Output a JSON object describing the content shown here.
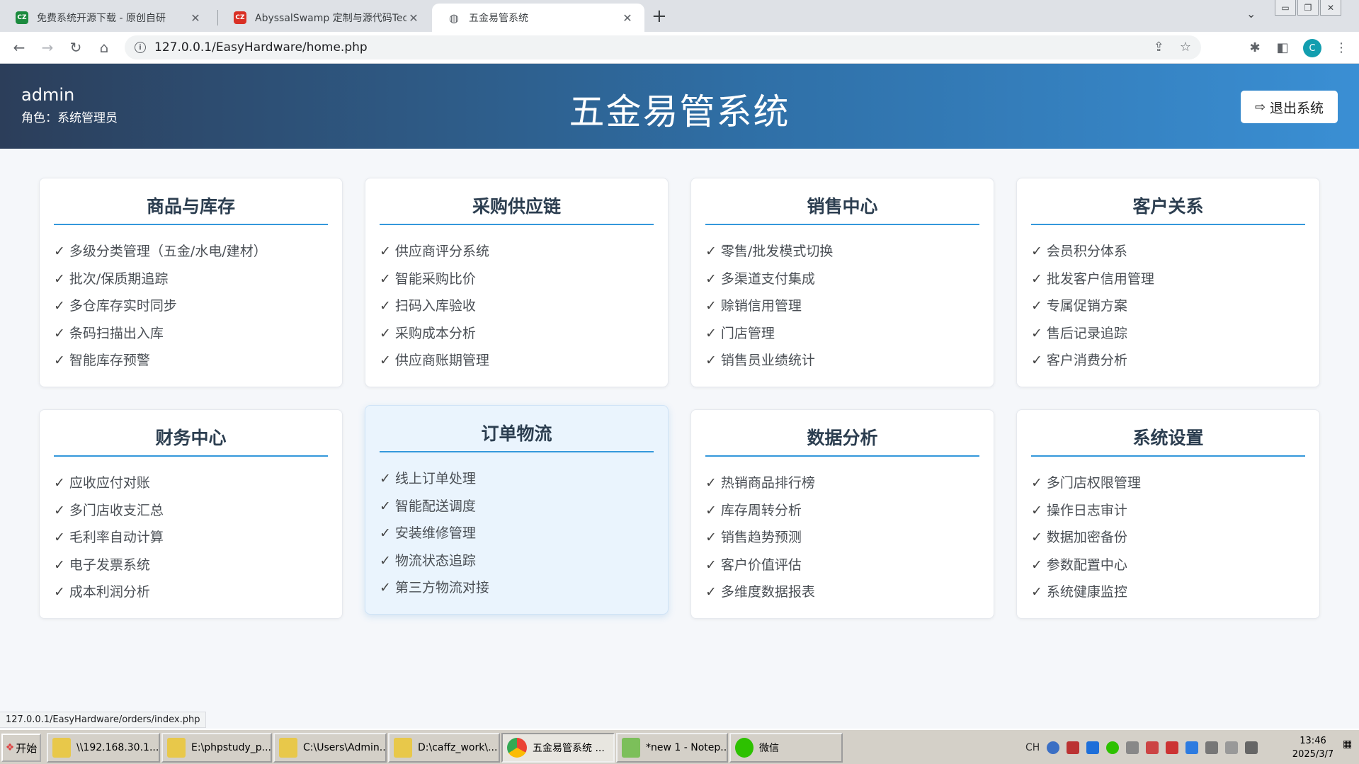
{
  "browser": {
    "tabs": [
      {
        "title": "免费系统开源下载 - 原创自研",
        "favicon": "CZ",
        "favicon_color": "#1b8a3e"
      },
      {
        "title": "AbyssalSwamp 定制与源代码Technol",
        "favicon": "CZ",
        "favicon_color": "#d93025"
      },
      {
        "title": "五金易管系统",
        "favicon": "globe-icon"
      }
    ],
    "url": "127.0.0.1/EasyHardware/home.php",
    "profile_initial": "C",
    "status_link": "127.0.0.1/EasyHardware/orders/index.php"
  },
  "header": {
    "username": "admin",
    "role": "角色：系统管理员",
    "title": "五金易管系统",
    "logout_label": "退出系统"
  },
  "modules": [
    {
      "title": "商品与库存",
      "items": [
        "多级分类管理（五金/水电/建材）",
        "批次/保质期追踪",
        "多仓库存实时同步",
        "条码扫描出入库",
        "智能库存预警"
      ]
    },
    {
      "title": "采购供应链",
      "items": [
        "供应商评分系统",
        "智能采购比价",
        "扫码入库验收",
        "采购成本分析",
        "供应商账期管理"
      ]
    },
    {
      "title": "销售中心",
      "items": [
        "零售/批发模式切换",
        "多渠道支付集成",
        "赊销信用管理",
        "门店管理",
        "销售员业绩统计"
      ]
    },
    {
      "title": "客户关系",
      "items": [
        "会员积分体系",
        "批发客户信用管理",
        "专属促销方案",
        "售后记录追踪",
        "客户消费分析"
      ]
    },
    {
      "title": "财务中心",
      "items": [
        "应收应付对账",
        "多门店收支汇总",
        "毛利率自动计算",
        "电子发票系统",
        "成本利润分析"
      ]
    },
    {
      "title": "订单物流",
      "items": [
        "线上订单处理",
        "智能配送调度",
        "安装维修管理",
        "物流状态追踪",
        "第三方物流对接"
      ]
    },
    {
      "title": "数据分析",
      "items": [
        "热销商品排行榜",
        "库存周转分析",
        "销售趋势预测",
        "客户价值评估",
        "多维度数据报表"
      ]
    },
    {
      "title": "系统设置",
      "items": [
        "多门店权限管理",
        "操作日志审计",
        "数据加密备份",
        "参数配置中心",
        "系统健康监控"
      ]
    }
  ],
  "check_mark": "✓",
  "taskbar": {
    "start_label": "开始",
    "tasks": [
      "\\\\192.168.30.1...",
      "E:\\phpstudy_p...",
      "C:\\Users\\Admin...",
      "D:\\caffz_work\\...",
      "五金易管系统 ...",
      "*new 1 - Notep...",
      "微信"
    ],
    "tray_lang": "CH",
    "clock_time": "13:46",
    "clock_date": "2025/3/7"
  },
  "colors": {
    "header_start": "#2c3e5a",
    "header_end": "#3a8fd4",
    "accent": "#3498db",
    "active_card": "#eaf4fd"
  }
}
